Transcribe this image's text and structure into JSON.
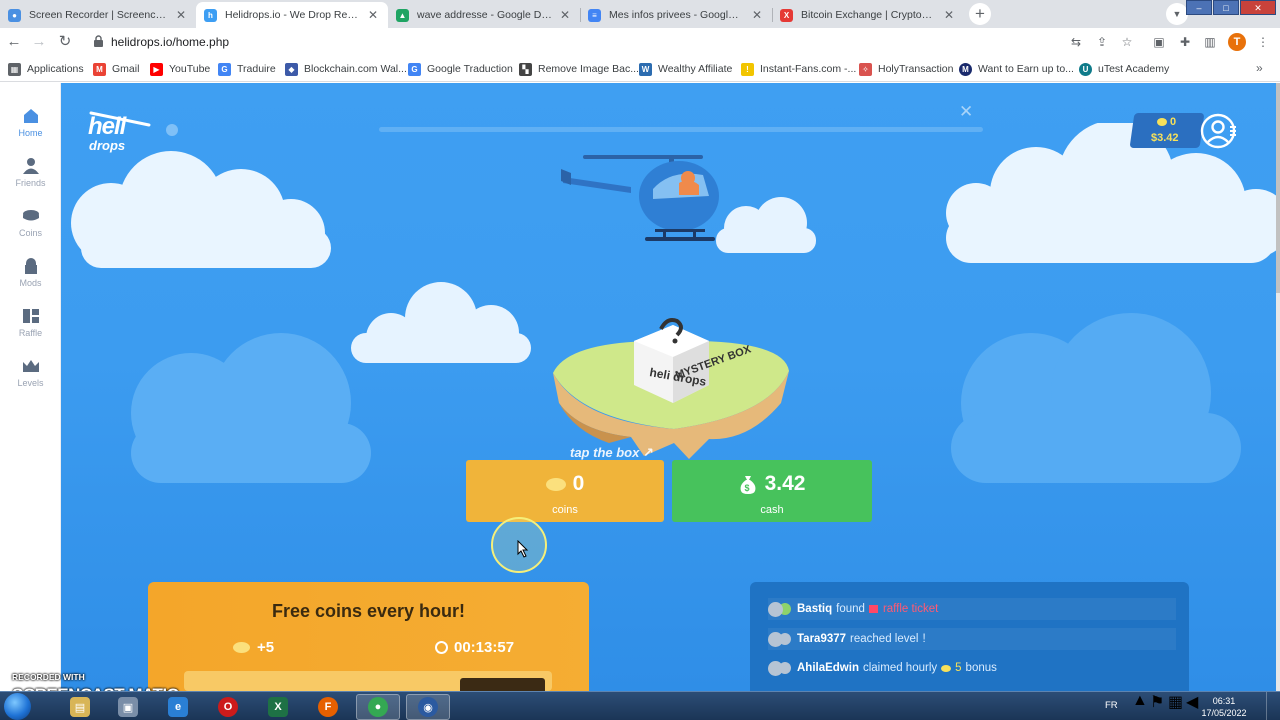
{
  "browser": {
    "tabs": [
      {
        "title": "Screen Recorder | Screencast-O-Matic",
        "icon": "screencast-icon",
        "color": "#4a90e2",
        "active": false
      },
      {
        "title": "Helidrops.io - We Drop Rewards!",
        "icon": "helidrops-icon",
        "color": "#3d9ef3",
        "active": true
      },
      {
        "title": "wave addresse - Google Disque",
        "icon": "google-drive-icon",
        "color": "#1fa463",
        "active": false
      },
      {
        "title": "Mes infos privees - Google Docs",
        "icon": "google-docs-icon",
        "color": "#4285f4",
        "active": false
      },
      {
        "title": "Bitcoin Exchange | Cryptocurrency",
        "icon": "exchange-icon",
        "color": "#e53935",
        "active": false
      }
    ],
    "url": "helidrops.io/home.php",
    "profile_initial": "T",
    "bookmarks": [
      {
        "label": "Applications",
        "icon": "apps-grid-icon",
        "color": "#5f6368"
      },
      {
        "label": "Gmail",
        "icon": "gmail-icon",
        "color": "#ea4335"
      },
      {
        "label": "YouTube",
        "icon": "youtube-icon",
        "color": "#ff0000"
      },
      {
        "label": "Traduire",
        "icon": "translate-icon",
        "color": "#4285f4"
      },
      {
        "label": "Blockchain.com Wal...",
        "icon": "blockchain-icon",
        "color": "#3d5aa8"
      },
      {
        "label": "Google Traduction",
        "icon": "translate-icon",
        "color": "#4285f4"
      },
      {
        "label": "Remove Image Bac...",
        "icon": "remove-bg-icon",
        "color": "#444"
      },
      {
        "label": "Wealthy Affiliate",
        "icon": "wealthy-affiliate-icon",
        "color": "#2c6cb0"
      },
      {
        "label": "Instant-Fans.com -...",
        "icon": "instant-fans-icon",
        "color": "#f2c500"
      },
      {
        "label": "HolyTransaction",
        "icon": "holytransaction-icon",
        "color": "#d9534f"
      },
      {
        "label": "Want to Earn up to...",
        "icon": "mp-icon",
        "color": "#1a2a6c"
      },
      {
        "label": "uTest Academy",
        "icon": "utest-icon",
        "color": "#0f7b8a"
      }
    ]
  },
  "sidebar": {
    "items": [
      {
        "label": "Home",
        "icon": "home-icon",
        "active": true
      },
      {
        "label": "Friends",
        "icon": "friends-icon",
        "active": false
      },
      {
        "label": "Coins",
        "icon": "coins-icon",
        "active": false
      },
      {
        "label": "Mods",
        "icon": "mods-icon",
        "active": false
      },
      {
        "label": "Raffle",
        "icon": "raffle-icon",
        "active": false
      },
      {
        "label": "Levels",
        "icon": "levels-icon",
        "active": false
      }
    ]
  },
  "game": {
    "logo_line1": "heli",
    "logo_line2": "drops",
    "balance_coins": "0",
    "balance_cash": "$3.42",
    "box_label_top": "heli drops",
    "box_label_side": "MYSTERY BOX",
    "tap_hint": "tap the box",
    "coins_value": "0",
    "coins_label": "coins",
    "cash_value": "3.42",
    "cash_label": "cash",
    "hourly_title": "Free coins every hour!",
    "hourly_amount": "+5",
    "hourly_timer": "00:13:57",
    "hourly_progress": 0.23,
    "activity": [
      {
        "user": "Bastiq",
        "action": "found",
        "reward": "raffle ticket",
        "type": "raffle"
      },
      {
        "user": "Tara9377",
        "action": "reached level",
        "reward": "!",
        "type": "level"
      },
      {
        "user": "AhilaEdwin",
        "action": "claimed hourly",
        "reward": "5",
        "suffix": "bonus",
        "type": "coins"
      }
    ]
  },
  "watermark": {
    "line1": "RECORDED WITH",
    "line2": "SCREENCAST MATIC"
  },
  "taskbar": {
    "lang": "FR",
    "time": "06:31",
    "date": "17/05/2022"
  }
}
